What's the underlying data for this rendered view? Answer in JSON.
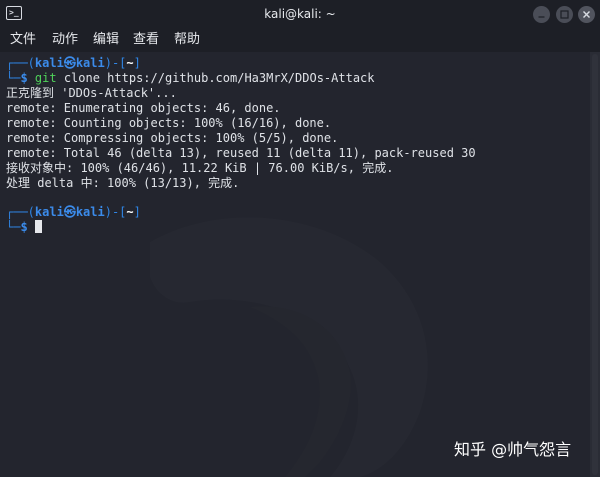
{
  "window": {
    "title": "kali@kali: ~"
  },
  "menubar": {
    "items": [
      "文件",
      "动作",
      "编辑",
      "查看",
      "帮助"
    ]
  },
  "terminal": {
    "prompt1": {
      "open": "┌──(",
      "user": "kali",
      "at": "㉿",
      "host": "kali",
      "sep": ")-[",
      "dir": "~",
      "close": "]",
      "lower": "└─",
      "dollar": "$",
      "cmd_name": "git",
      "cmd_args": " clone https://github.com/Ha3MrX/DDOs-Attack"
    },
    "output": [
      "正克隆到 'DDOs-Attack'...",
      "remote: Enumerating objects: 46, done.",
      "remote: Counting objects: 100% (16/16), done.",
      "remote: Compressing objects: 100% (5/5), done.",
      "remote: Total 46 (delta 13), reused 11 (delta 11), pack-reused 30",
      "接收对象中: 100% (46/46), 11.22 KiB | 76.00 KiB/s, 完成.",
      "处理 delta 中: 100% (13/13), 完成."
    ],
    "prompt2": {
      "open": "┌──(",
      "user": "kali",
      "at": "㉿",
      "host": "kali",
      "sep": ")-[",
      "dir": "~",
      "close": "]",
      "lower": "└─",
      "dollar": "$"
    }
  },
  "watermark": {
    "text": "知乎 @帅气怨言"
  },
  "colors": {
    "background": "#23252e",
    "titlebar": "#1d1f26",
    "prompt_blue": "#2f86e6",
    "command_green": "#4fd15a"
  },
  "icons": {
    "app": "terminal-icon",
    "minimize": "minimize-icon",
    "maximize": "maximize-icon",
    "close": "close-icon"
  }
}
